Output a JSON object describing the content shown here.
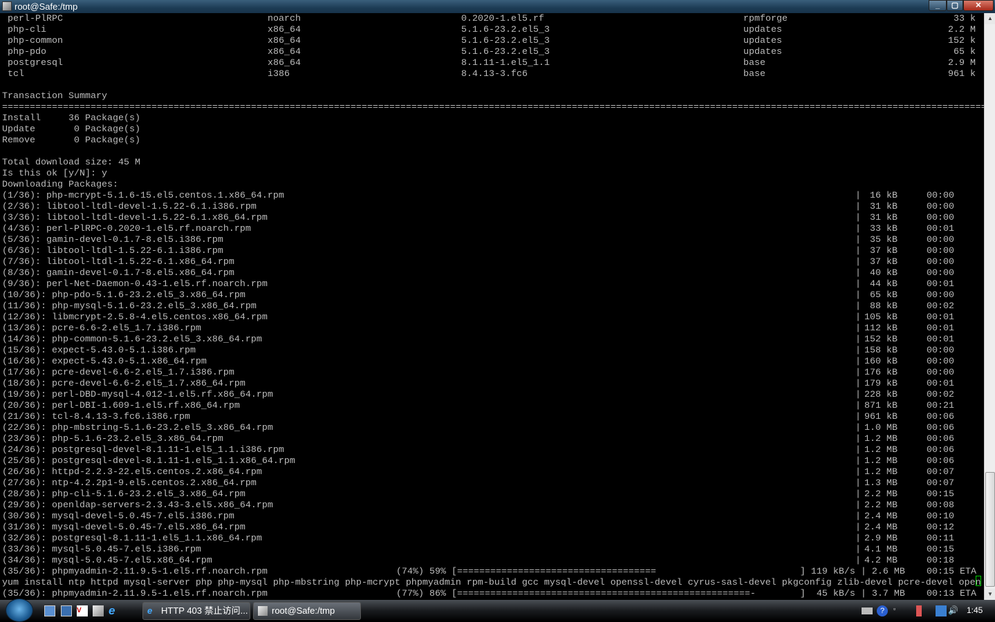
{
  "window": {
    "title": "root@Safe:/tmp",
    "minimize": "_",
    "maximize": "▢",
    "close": "✕"
  },
  "packages": [
    {
      "name": "perl-PlRPC",
      "arch": "noarch",
      "version": "0.2020-1.el5.rf",
      "repo": "rpmforge",
      "size": "33 k"
    },
    {
      "name": "php-cli",
      "arch": "x86_64",
      "version": "5.1.6-23.2.el5_3",
      "repo": "updates",
      "size": "2.2 M"
    },
    {
      "name": "php-common",
      "arch": "x86_64",
      "version": "5.1.6-23.2.el5_3",
      "repo": "updates",
      "size": "152 k"
    },
    {
      "name": "php-pdo",
      "arch": "x86_64",
      "version": "5.1.6-23.2.el5_3",
      "repo": "updates",
      "size": "65 k"
    },
    {
      "name": "postgresql",
      "arch": "x86_64",
      "version": "8.1.11-1.el5_1.1",
      "repo": "base",
      "size": "2.9 M"
    },
    {
      "name": "tcl",
      "arch": "i386",
      "version": "8.4.13-3.fc6",
      "repo": "base",
      "size": "961 k"
    }
  ],
  "summary": {
    "heading": "Transaction Summary",
    "rule": "==================================================================================================================================================================================",
    "lines": [
      "Install     36 Package(s)",
      "Update       0 Package(s)",
      "Remove       0 Package(s)"
    ],
    "total": "Total download size: 45 M",
    "prompt": "Is this ok [y/N]: y",
    "downloading": "Downloading Packages:"
  },
  "downloads": [
    {
      "file": "(1/36): php-mcrypt-5.1.6-15.el5.centos.1.x86_64.rpm",
      "size": "16 kB",
      "time": "00:00"
    },
    {
      "file": "(2/36): libtool-ltdl-devel-1.5.22-6.1.i386.rpm",
      "size": "31 kB",
      "time": "00:00"
    },
    {
      "file": "(3/36): libtool-ltdl-devel-1.5.22-6.1.x86_64.rpm",
      "size": "31 kB",
      "time": "00:00"
    },
    {
      "file": "(4/36): perl-PlRPC-0.2020-1.el5.rf.noarch.rpm",
      "size": "33 kB",
      "time": "00:01"
    },
    {
      "file": "(5/36): gamin-devel-0.1.7-8.el5.i386.rpm",
      "size": "35 kB",
      "time": "00:00"
    },
    {
      "file": "(6/36): libtool-ltdl-1.5.22-6.1.i386.rpm",
      "size": "37 kB",
      "time": "00:00"
    },
    {
      "file": "(7/36): libtool-ltdl-1.5.22-6.1.x86_64.rpm",
      "size": "37 kB",
      "time": "00:00"
    },
    {
      "file": "(8/36): gamin-devel-0.1.7-8.el5.x86_64.rpm",
      "size": "40 kB",
      "time": "00:00"
    },
    {
      "file": "(9/36): perl-Net-Daemon-0.43-1.el5.rf.noarch.rpm",
      "size": "44 kB",
      "time": "00:01"
    },
    {
      "file": "(10/36): php-pdo-5.1.6-23.2.el5_3.x86_64.rpm",
      "size": "65 kB",
      "time": "00:00"
    },
    {
      "file": "(11/36): php-mysql-5.1.6-23.2.el5_3.x86_64.rpm",
      "size": "88 kB",
      "time": "00:02"
    },
    {
      "file": "(12/36): libmcrypt-2.5.8-4.el5.centos.x86_64.rpm",
      "size": "105 kB",
      "time": "00:01"
    },
    {
      "file": "(13/36): pcre-6.6-2.el5_1.7.i386.rpm",
      "size": "112 kB",
      "time": "00:01"
    },
    {
      "file": "(14/36): php-common-5.1.6-23.2.el5_3.x86_64.rpm",
      "size": "152 kB",
      "time": "00:01"
    },
    {
      "file": "(15/36): expect-5.43.0-5.1.i386.rpm",
      "size": "158 kB",
      "time": "00:00"
    },
    {
      "file": "(16/36): expect-5.43.0-5.1.x86_64.rpm",
      "size": "160 kB",
      "time": "00:00"
    },
    {
      "file": "(17/36): pcre-devel-6.6-2.el5_1.7.i386.rpm",
      "size": "176 kB",
      "time": "00:00"
    },
    {
      "file": "(18/36): pcre-devel-6.6-2.el5_1.7.x86_64.rpm",
      "size": "179 kB",
      "time": "00:01"
    },
    {
      "file": "(19/36): perl-DBD-mysql-4.012-1.el5.rf.x86_64.rpm",
      "size": "228 kB",
      "time": "00:02"
    },
    {
      "file": "(20/36): perl-DBI-1.609-1.el5.rf.x86_64.rpm",
      "size": "871 kB",
      "time": "00:21"
    },
    {
      "file": "(21/36): tcl-8.4.13-3.fc6.i386.rpm",
      "size": "961 kB",
      "time": "00:06"
    },
    {
      "file": "(22/36): php-mbstring-5.1.6-23.2.el5_3.x86_64.rpm",
      "size": "1.0 MB",
      "time": "00:06"
    },
    {
      "file": "(23/36): php-5.1.6-23.2.el5_3.x86_64.rpm",
      "size": "1.2 MB",
      "time": "00:06"
    },
    {
      "file": "(24/36): postgresql-devel-8.1.11-1.el5_1.1.i386.rpm",
      "size": "1.2 MB",
      "time": "00:06"
    },
    {
      "file": "(25/36): postgresql-devel-8.1.11-1.el5_1.1.x86_64.rpm",
      "size": "1.2 MB",
      "time": "00:06"
    },
    {
      "file": "(26/36): httpd-2.2.3-22.el5.centos.2.x86_64.rpm",
      "size": "1.2 MB",
      "time": "00:07"
    },
    {
      "file": "(27/36): ntp-4.2.2p1-9.el5.centos.2.x86_64.rpm",
      "size": "1.3 MB",
      "time": "00:07"
    },
    {
      "file": "(28/36): php-cli-5.1.6-23.2.el5_3.x86_64.rpm",
      "size": "2.2 MB",
      "time": "00:15"
    },
    {
      "file": "(29/36): openldap-servers-2.3.43-3.el5.x86_64.rpm",
      "size": "2.2 MB",
      "time": "00:08"
    },
    {
      "file": "(30/36): mysql-devel-5.0.45-7.el5.i386.rpm",
      "size": "2.4 MB",
      "time": "00:10"
    },
    {
      "file": "(31/36): mysql-devel-5.0.45-7.el5.x86_64.rpm",
      "size": "2.4 MB",
      "time": "00:12"
    },
    {
      "file": "(32/36): postgresql-8.1.11-1.el5_1.1.x86_64.rpm",
      "size": "2.9 MB",
      "time": "00:11"
    },
    {
      "file": "(33/36): mysql-5.0.45-7.el5.i386.rpm",
      "size": "4.1 MB",
      "time": "00:15"
    },
    {
      "file": "(34/36): mysql-5.0.45-7.el5.x86_64.rpm",
      "size": "4.2 MB",
      "time": "00:18"
    }
  ],
  "progress": [
    {
      "file": "(35/36): phpmyadmin-2.11.9.5-1.el5.rf.noarch.rpm",
      "bar": "(74%) 59% [====================================                          ] 119 kB/s | 2.6 MB",
      "time": "00:15 ETA"
    },
    {
      "file": "(35/36): phpmyadmin-2.11.9.5-1.el5.rf.noarch.rpm",
      "bar": "(77%) 86% [=====================================================-        ]  45 kB/s | 3.7 MB",
      "time": "00:13 ETA"
    }
  ],
  "command": "yum install ntp httpd mysql-server php php-mysql php-mbstring php-mcrypt phpmyadmin rpm-build gcc mysql-devel openssl-devel cyrus-sasl-devel pkgconfig zlib-devel pcre-devel open",
  "taskbar": {
    "tasks": [
      {
        "label": "HTTP 403 禁止访问..."
      },
      {
        "label": "root@Safe:/tmp"
      }
    ],
    "clock": "1:45"
  }
}
